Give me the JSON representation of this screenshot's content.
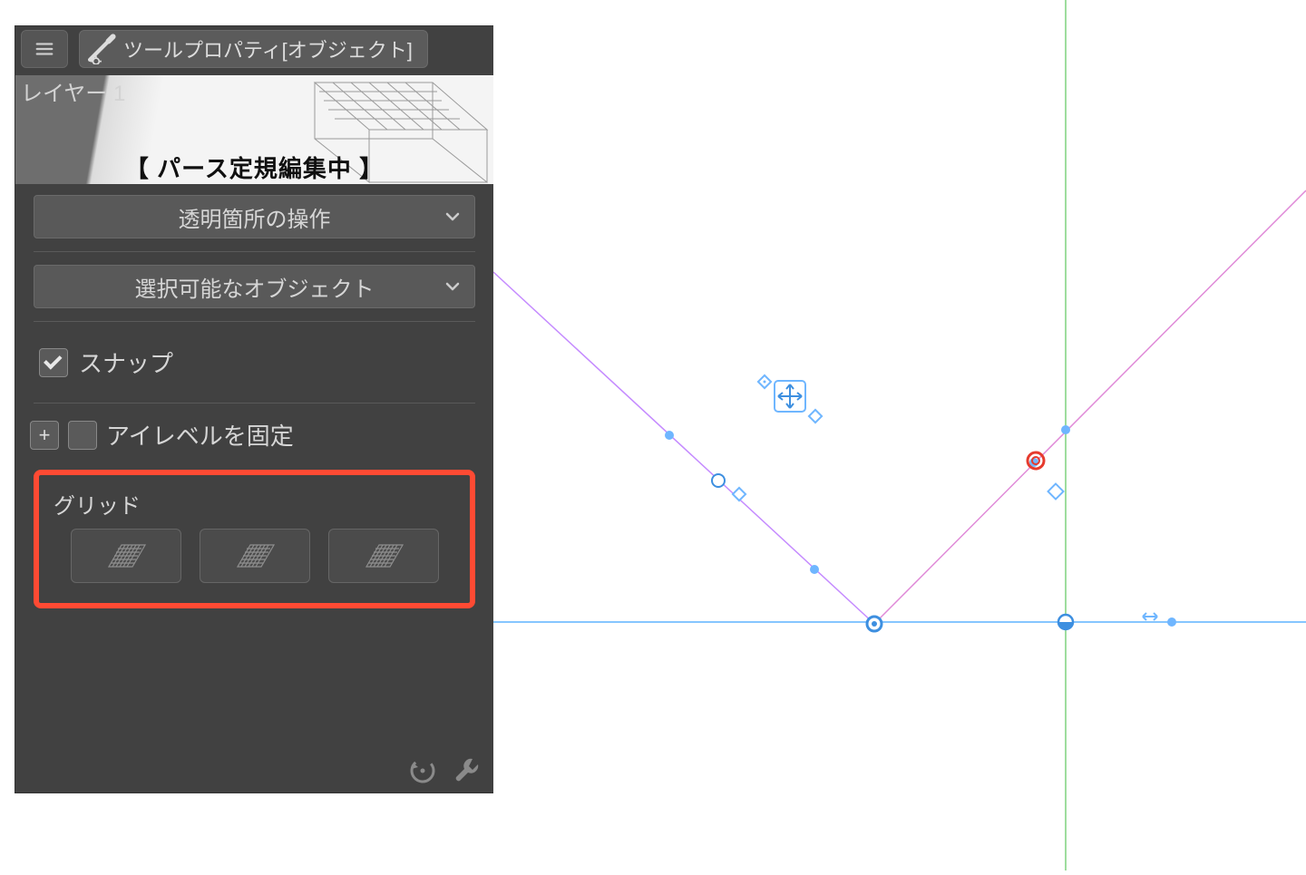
{
  "header": {
    "title": "ツールプロパティ[オブジェクト]"
  },
  "preview": {
    "layer_label": "レイヤー 1",
    "editing_label": "【 パース定規編集中 】"
  },
  "dropdowns": {
    "transparent_ops": "透明箇所の操作",
    "selectable_objects": "選択可能なオブジェクト"
  },
  "options": {
    "snap": {
      "label": "スナップ",
      "checked": true
    },
    "fix_eye_level": {
      "label": "アイレベルを固定",
      "checked": false
    }
  },
  "grid": {
    "title": "グリッド"
  },
  "colors": {
    "highlight": "#ff4a33",
    "horizon": "#4aa8ff",
    "vp_line": "#c58bff",
    "vertical": "#6ecb6e"
  }
}
